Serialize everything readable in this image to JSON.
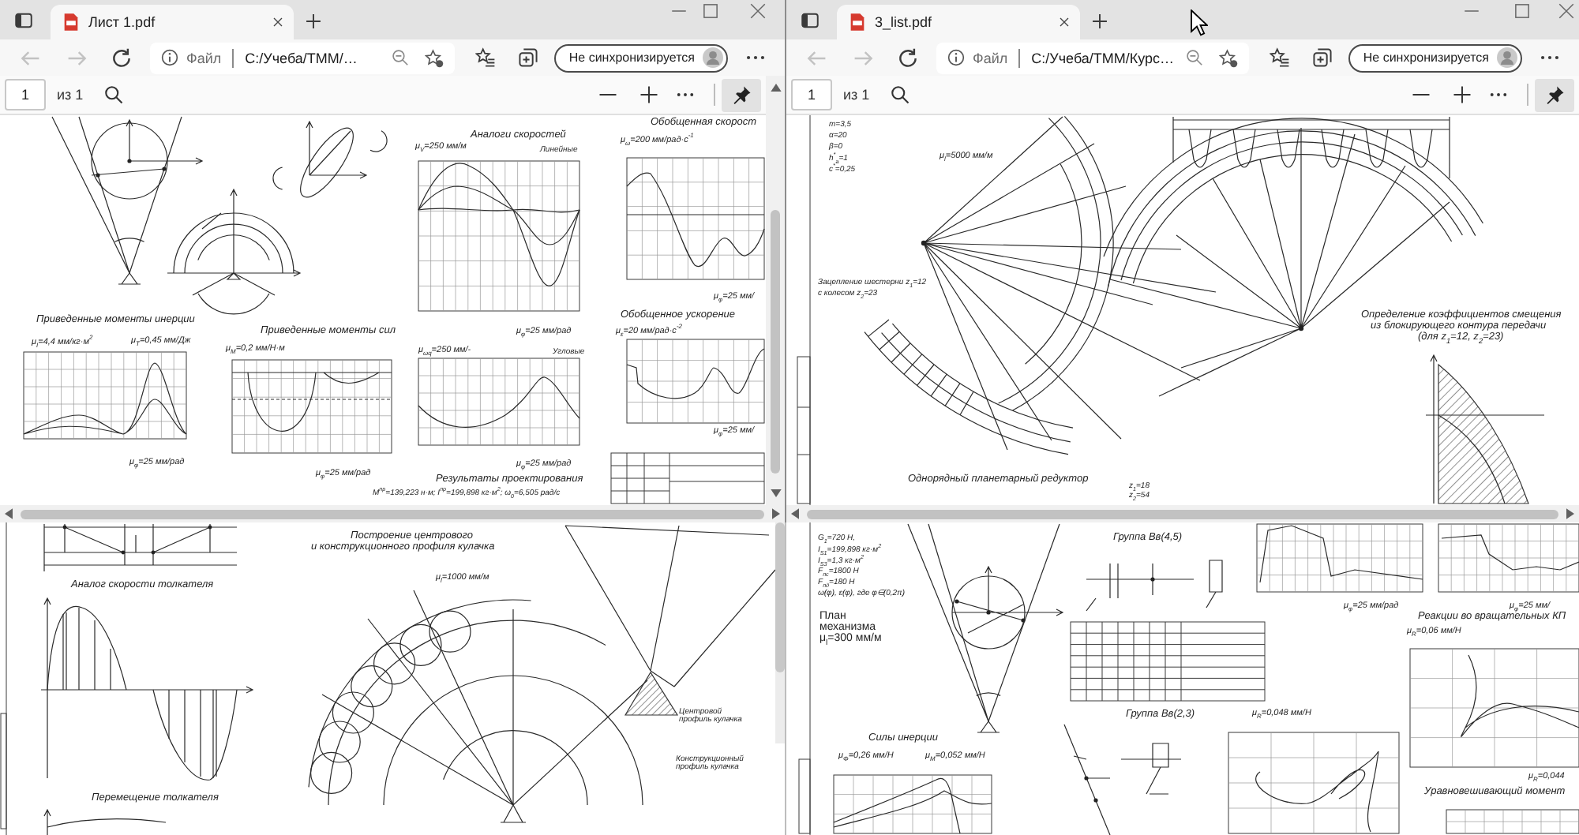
{
  "windows": [
    {
      "tab": {
        "title": "Лист 1.pdf",
        "selected": true
      },
      "back": {
        "disabled": true
      },
      "forward": {
        "disabled": true
      },
      "address": {
        "label": "Файл",
        "value": "C:/Учеба/ТММ/…"
      },
      "profile": {
        "label": "Не синхронизируется"
      },
      "pdf_toolbar": {
        "page": "1",
        "page_count": "из 1"
      },
      "document": {
        "labels": [
          {
            "kind": "title",
            "text": "Аналоги скоростей"
          },
          {
            "kind": "note",
            "text": "Линейные"
          },
          {
            "kind": "scale",
            "text": "μ$_{V}$=250 мм/м"
          },
          {
            "kind": "title",
            "text": "Обобщенная скорост"
          },
          {
            "kind": "scale",
            "text": "μ$_{ω}$=200 мм/рад·с$^{-1}$"
          },
          {
            "kind": "scale",
            "text": "μ$_{φ}$=25 мм/"
          },
          {
            "kind": "title",
            "text": "Приведенные моменты инерции"
          },
          {
            "kind": "scale",
            "text": "μ$_{I}$=4,4 мм/кг·м$^{2}$"
          },
          {
            "kind": "scale",
            "text": "μ$_{T}$=0,45 мм/Дж"
          },
          {
            "kind": "title",
            "text": "Приведенные моменты сил"
          },
          {
            "kind": "scale",
            "text": "μ$_{M}$=0,2 мм/Н·м"
          },
          {
            "kind": "scale",
            "text": "μ$_{φ}$=25 мм/рад"
          },
          {
            "kind": "scale",
            "text": "μ$_{ωq}$=250 мм/-"
          },
          {
            "kind": "note",
            "text": "Угловые"
          },
          {
            "kind": "title",
            "text": "Обобщенное ускорение"
          },
          {
            "kind": "scale",
            "text": "μ$_{ε}$=20 мм/рад·с$^{-2}$"
          },
          {
            "kind": "scale",
            "text": "μ$_{φ}$=25 мм/"
          },
          {
            "kind": "scale",
            "text": "μ$_{φ}$=25 мм/рад"
          },
          {
            "kind": "scale",
            "text": "μ$_{φ}$=25 мм/рад"
          },
          {
            "kind": "scale",
            "text": "μ$_{φ}$=25 мм/рад"
          },
          {
            "kind": "title",
            "text": "Результаты проектирования"
          },
          {
            "kind": "note",
            "text": "M$^{пр}$=139,223 н·м; I$^{пр}$=199,898 кг·м$^{2}$; ω$_{0}$=6,505 рад/с"
          }
        ]
      }
    },
    {
      "tab": {
        "title": "3_list.pdf",
        "selected": true
      },
      "back": {
        "disabled": true
      },
      "forward": {
        "disabled": true
      },
      "address": {
        "label": "Файл",
        "value": "C:/Учеба/ТММ/Курс…"
      },
      "profile": {
        "label": "Не синхронизируется"
      },
      "pdf_toolbar": {
        "page": "1",
        "page_count": "из 1"
      },
      "document": {
        "labels": [
          {
            "kind": "note",
            "text": "m=3,5"
          },
          {
            "kind": "note",
            "text": "α=20"
          },
          {
            "kind": "note",
            "text": "β=0"
          },
          {
            "kind": "note",
            "text": "h$^{*}$$_{a}$=1"
          },
          {
            "kind": "note",
            "text": "c$^{*}$=0,25"
          },
          {
            "kind": "scale",
            "text": "μ$_{l}$=5000 мм/м"
          },
          {
            "kind": "note",
            "text": "Зацепление шестерни z$_{1}$=12"
          },
          {
            "kind": "note",
            "text": "с колесом z$_{2}$=23"
          },
          {
            "kind": "title",
            "text": "Однорядный планетарный редуктор"
          },
          {
            "kind": "title",
            "text": "Определение коэффициентов смещения"
          },
          {
            "kind": "title",
            "text": "из блокирующего контура передачи"
          },
          {
            "kind": "title",
            "text": "(для z$_{1}$=12, z$_{2}$=23)"
          },
          {
            "kind": "note",
            "text": "z$_{1}$=18"
          },
          {
            "kind": "note",
            "text": "z$_{2}$=54"
          }
        ]
      }
    }
  ],
  "background_windows": [
    {
      "document": {
        "labels": [
          {
            "kind": "title",
            "text": "Построение центрового"
          },
          {
            "kind": "title",
            "text": "и конструкционного профиля кулачка"
          },
          {
            "kind": "title",
            "text": "Аналог скорости толкателя"
          },
          {
            "kind": "scale",
            "text": "μ$_{l}$=1000 мм/м"
          },
          {
            "kind": "note",
            "text": "Центровой профиль кулачка"
          },
          {
            "kind": "note",
            "text": "Конструкционный профиль кулачка"
          },
          {
            "kind": "title",
            "text": "Перемещение толкателя"
          }
        ]
      }
    },
    {
      "document": {
        "labels": [
          {
            "kind": "note",
            "text": "G$_{1}$=720 Н,"
          },
          {
            "kind": "note",
            "text": "I$_{S1}$=199,898 кг·м$^{2}$"
          },
          {
            "kind": "note",
            "text": "I$_{S3}$=1,3 кг·м$^{2}$"
          },
          {
            "kind": "note",
            "text": "F$_{пс}$=1800 Н"
          },
          {
            "kind": "note",
            "text": "F$_{пд}$=180 Н"
          },
          {
            "kind": "note",
            "text": "ω(φ), ε(φ), где φ∈(0,2π)"
          },
          {
            "kind": "label",
            "text": "План"
          },
          {
            "kind": "label",
            "text": "механизма"
          },
          {
            "kind": "label",
            "text": "μ$_{l}$=300 мм/м"
          },
          {
            "kind": "title",
            "text": "Группа Вв(4,5)"
          },
          {
            "kind": "title",
            "text": "Группа Вв(2,3)"
          },
          {
            "kind": "title",
            "text": "Силы инерции"
          },
          {
            "kind": "scale",
            "text": "μ$_{Φ}$=0,26 мм/Н"
          },
          {
            "kind": "scale",
            "text": "μ$_{M}$=0,052 мм/Н"
          },
          {
            "kind": "scale",
            "text": "μ$_{φ}$=25 мм/рад"
          },
          {
            "kind": "scale",
            "text": "μ$_{φ}$=25 мм/"
          },
          {
            "kind": "title",
            "text": "Реакции во вращательных КП"
          },
          {
            "kind": "scale",
            "text": "μ$_{R}$=0,06 мм/Н"
          },
          {
            "kind": "scale",
            "text": "μ$_{R}$=0,048 мм/Н"
          },
          {
            "kind": "scale",
            "text": "μ$_{R}$=0,044"
          },
          {
            "kind": "title",
            "text": "Уравновешивающий момент"
          }
        ]
      }
    }
  ]
}
